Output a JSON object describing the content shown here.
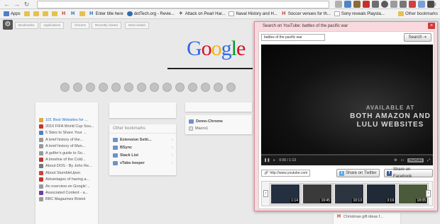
{
  "browser": {
    "url": "",
    "bookmarks": [
      {
        "label": "Apps",
        "icon": "apps-grid-icon"
      },
      {
        "label": "",
        "icon": "folder-icon"
      },
      {
        "label": "",
        "icon": "folder-icon"
      },
      {
        "label": "",
        "icon": "folder-icon"
      },
      {
        "label": "",
        "icon": "folder-icon"
      },
      {
        "label": "",
        "icon": "h-favicon"
      },
      {
        "label": "",
        "icon": "h-favicon"
      },
      {
        "label": "",
        "icon": "folder-icon"
      },
      {
        "label": "Enter title here",
        "icon": "h-favicon"
      },
      {
        "label": "dotTech.org - Revie...",
        "icon": "dottech-favicon"
      },
      {
        "label": "Attack on Pearl Har...",
        "icon": "plane-favicon"
      },
      {
        "label": "Naval History and H...",
        "icon": "page-favicon"
      },
      {
        "label": "Soccer venues for th...",
        "icon": "h-favicon"
      },
      {
        "label": "Sony reveals Playsta...",
        "icon": "page-favicon"
      }
    ],
    "other_bookmarks": "Other bookmarks"
  },
  "newtab": {
    "tabs": [
      "Bookmarks",
      "Applications",
      "Chrome",
      "Recently closed",
      "Most visited"
    ],
    "logo": "Google",
    "logo_colors": [
      "#3369e8",
      "#d50f25",
      "#eeb211",
      "#3369e8",
      "#009925",
      "#d50f25"
    ],
    "recent_list": [
      {
        "label": "101 Best Websites for ...",
        "highlight": true
      },
      {
        "label": "2010 FIFA World Cup Sou..."
      },
      {
        "label": "5 Sites to Share Your ..."
      },
      {
        "label": "A brief history of the..."
      },
      {
        "label": "A brief history of Man..."
      },
      {
        "label": "A golfer's guide to So..."
      },
      {
        "label": "A timeline of the Cold..."
      },
      {
        "label": "About DOS - By John Re..."
      },
      {
        "label": "About StumbleUpon"
      },
      {
        "label": "Advantages of having a..."
      },
      {
        "label": "An overview on Google'..."
      },
      {
        "label": "Associated Content - a..."
      },
      {
        "label": "BBC Magazines Bristol"
      }
    ],
    "other_bookmarks_title": "Other bookmarks",
    "other_bookmarks_items": [
      "Extension Setti...",
      "BSync",
      "Stack List",
      "vTabs keeper"
    ],
    "demo_items": [
      "Demo-Chrome",
      "Macro1"
    ],
    "bottom_item": "Christmas gift ideas f..."
  },
  "popup": {
    "title": "Search on YouTube: battles of the pacific war",
    "query": "battles of the pacific war",
    "search_label": "Search",
    "promo": [
      "AVAILABLE AT",
      "BOTH AMAZON AND",
      "LULU WEBSITES"
    ],
    "time": "0:00 / 1:13",
    "progress": 0,
    "yt_logo": "YouTube",
    "url_chip": "http://www.youtube.com",
    "share_twitter": "Share on Twitter",
    "share_facebook": "Share on Facebook",
    "thumbs": [
      {
        "duration": "1:14"
      },
      {
        "duration": "19:45"
      },
      {
        "duration": "10:13"
      },
      {
        "duration": "3:19"
      },
      {
        "duration": "18:05"
      }
    ]
  }
}
